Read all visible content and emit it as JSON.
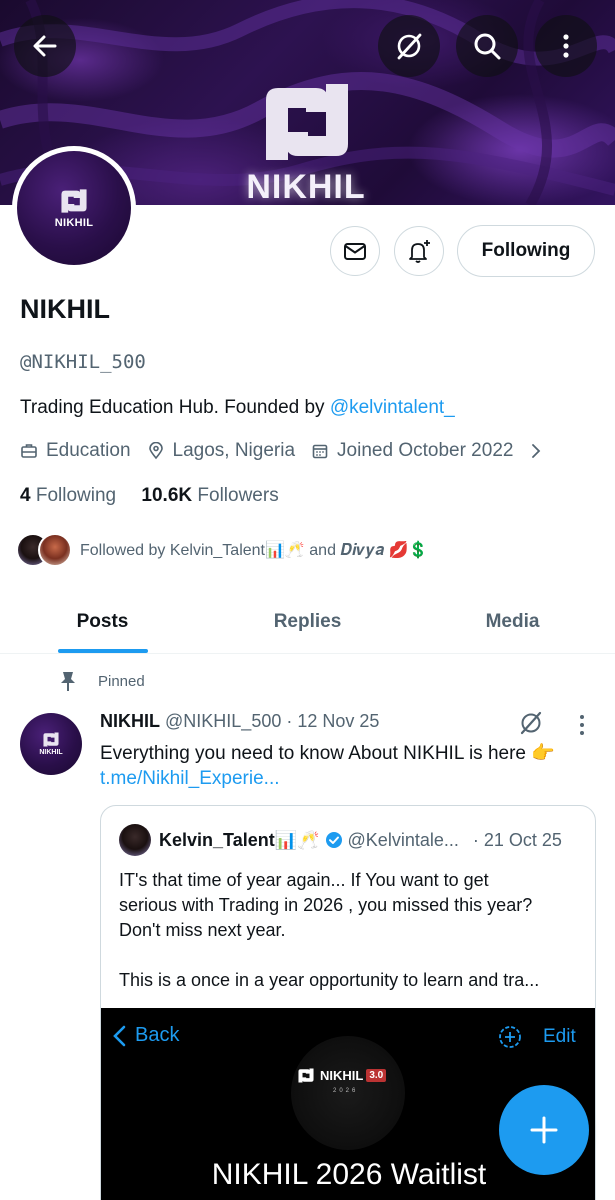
{
  "banner": {
    "wordmark": "NIKHIL"
  },
  "header": {
    "back_icon": "arrow-left-icon",
    "grok_icon": "grok-slash-icon",
    "search_icon": "search-icon",
    "more_icon": "more-vertical-icon"
  },
  "profile": {
    "avatar_wordmark": "NIKHIL",
    "name": "NIKHIL",
    "handle": "@NIKHIL_500",
    "bio_text": "Trading Education Hub.  Founded by ",
    "bio_mention": "@kelvintalent_",
    "category": "Education",
    "location": "Lagos, Nigeria",
    "joined": "Joined October 2022",
    "following_count": "4",
    "following_label": "Following",
    "followers_count": "10.6K",
    "followers_label": "Followers",
    "followed_by": "Followed by Kelvin_Talent📊🥂 and 𝑫𝒊𝒗𝒚𝒂 💋💲"
  },
  "actions": {
    "follow_label": "Following"
  },
  "tabs": [
    {
      "label": "Posts",
      "active": true
    },
    {
      "label": "Replies",
      "active": false
    },
    {
      "label": "Media",
      "active": false
    }
  ],
  "post": {
    "pinned_label": "Pinned",
    "avatar_wordmark": "NIKHIL",
    "author": "NIKHIL",
    "handle_date": "@NIKHIL_500 · 12 Nov 25",
    "text": "Everything you need to know About NIKHIL is here 👉",
    "link": "t.me/Nikhil_Experie...",
    "quote": {
      "author": "Kelvin_Talent📊🥂",
      "handle": "@Kelvintale...",
      "date": "· 21 Oct 25",
      "lines": [
        "IT's that time of year again... If You want to get",
        "serious with Trading in 2026 , you missed this year?",
        "Don't miss next year.",
        "",
        "This is a once in a year opportunity to learn and tra..."
      ],
      "image": {
        "back_label": "Back",
        "edit_label": "Edit",
        "logo_text": "NIKHIL",
        "logo_version": "3.0",
        "logo_year": "2026",
        "title": "NIKHIL 2026 Waitlist"
      }
    }
  },
  "colors": {
    "accent": "#1d9bf0",
    "text": "#0f1419",
    "muted": "#536471",
    "border": "#cfd9de"
  }
}
